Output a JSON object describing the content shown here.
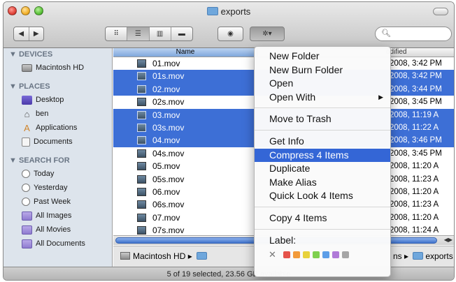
{
  "window": {
    "title": "exports"
  },
  "toolbar": {
    "back": "◀",
    "forward": "▶",
    "views": [
      "⠿",
      "☰",
      "▥",
      "▬"
    ],
    "quicklook": "◉",
    "action": "✲▾",
    "search_icon": "search-icon"
  },
  "sidebar": {
    "devices_head": "▼ DEVICES",
    "devices": [
      "Macintosh HD"
    ],
    "places_head": "▼ PLACES",
    "places": [
      "Desktop",
      "ben",
      "Applications",
      "Documents"
    ],
    "search_head": "▼ SEARCH FOR",
    "searches": [
      "Today",
      "Yesterday",
      "Past Week",
      "All Images",
      "All Movies",
      "All Documents"
    ]
  },
  "list": {
    "col_name": "Name",
    "col_modified": "odified",
    "rows": [
      {
        "name": "01.mov",
        "date": "2008, 3:42 PM"
      },
      {
        "name": "01s.mov",
        "date": "2008, 3:42 PM"
      },
      {
        "name": "02.mov",
        "date": "2008, 3:44 PM"
      },
      {
        "name": "02s.mov",
        "date": "2008, 3:45 PM"
      },
      {
        "name": "03.mov",
        "date": "2008, 11:19 A"
      },
      {
        "name": "03s.mov",
        "date": "2008, 11:22 A"
      },
      {
        "name": "04.mov",
        "date": "2008, 3:46 PM"
      },
      {
        "name": "04s.mov",
        "date": "2008, 3:45 PM"
      },
      {
        "name": "05.mov",
        "date": "2008, 11:20 A"
      },
      {
        "name": "05s.mov",
        "date": "2008, 11:23 A"
      },
      {
        "name": "06.mov",
        "date": "2008, 11:20 A"
      },
      {
        "name": "06s.mov",
        "date": "2008, 11:23 A"
      },
      {
        "name": "07.mov",
        "date": "2008, 11:20 A"
      },
      {
        "name": "07s.mov",
        "date": "2008, 11:24 A"
      }
    ]
  },
  "pathbar": {
    "left": "Macintosh HD ▸ ",
    "right": "ns ▸ ",
    "folder": "exports"
  },
  "status": "5 of 19 selected, 23.56 GB available",
  "menu": {
    "items_a": [
      "New Folder",
      "New Burn Folder",
      "Open",
      "Open With"
    ],
    "items_b": [
      "Move to Trash"
    ],
    "items_c": [
      "Get Info",
      "Compress 4 Items",
      "Duplicate",
      "Make Alias",
      "Quick Look 4 Items"
    ],
    "items_d": [
      "Copy 4 Items"
    ],
    "label": "Label:",
    "clear": "✕",
    "submenu_arrow": "▶",
    "label_colors": [
      "#e5534b",
      "#f29a3a",
      "#e8d23c",
      "#7fd04f",
      "#5d9ee8",
      "#b07ad8",
      "#a6a6a6"
    ]
  }
}
